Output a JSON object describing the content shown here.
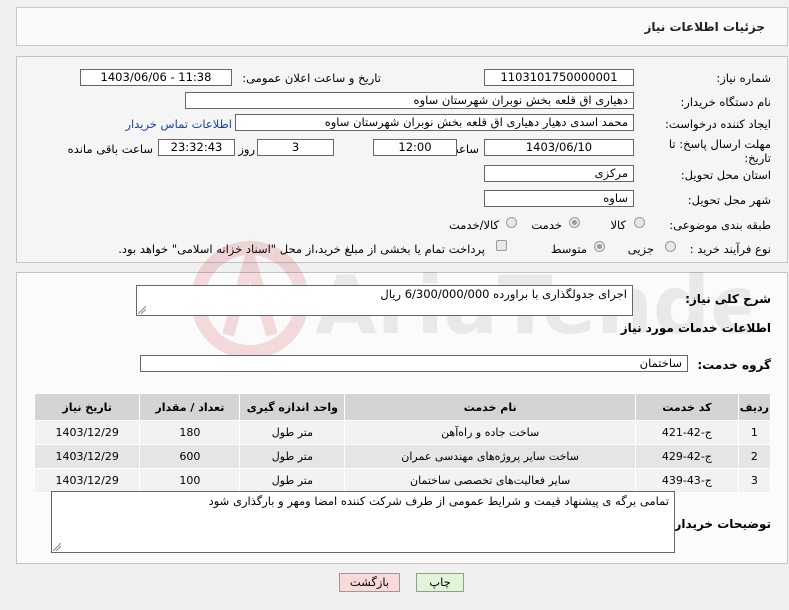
{
  "header": {
    "title": "جزئیات اطلاعات نیاز"
  },
  "info": {
    "need_number_label": "شماره نیاز:",
    "need_number": "1103101750000001",
    "announce_label": "تاریخ و ساعت اعلان عمومی:",
    "announce_value": "1403/06/06 - 11:38",
    "buyer_org_label": "نام دستگاه خریدار:",
    "buyer_org": "دهیاری اق قلعه بخش نوبران شهرستان ساوه",
    "creator_label": "ایجاد کننده درخواست:",
    "creator": "محمد اسدی دهیار دهیاری اق قلعه بخش نوبران شهرستان ساوه",
    "contact_link": "اطلاعات تماس خریدار",
    "deadline_label": "مهلت ارسال پاسخ: تا تاریخ:",
    "deadline_date": "1403/06/10",
    "time_label": "ساعت",
    "deadline_time": "12:00",
    "days_value": "3",
    "days_label": "روز و",
    "remaining_time": "23:32:43",
    "remaining_label": "ساعت باقی مانده",
    "province_label": "استان محل تحویل:",
    "province": "مرکزی",
    "city_label": "شهر محل تحویل:",
    "city": "ساوه",
    "category_label": "طبقه بندی موضوعی:",
    "category_options": [
      "کالا",
      "خدمت",
      "کالا/خدمت"
    ],
    "category_selected": "خدمت",
    "process_label": "نوع فرآیند خرید :",
    "process_options": [
      "جزیی",
      "متوسط"
    ],
    "process_selected": "متوسط",
    "payment_note": "پرداخت تمام یا بخشی از مبلغ خرید،از محل \"اسناد خزانه اسلامی\" خواهد بود."
  },
  "main": {
    "summary_label": "شرح کلی نیاز:",
    "summary_value": "اجرای جدولگذاری با براورده 6/300/000/000 ریال",
    "services_title": "اطلاعات خدمات مورد نیاز",
    "service_group_label": "گروه خدمت:",
    "service_group": "ساختمان",
    "table": {
      "headers": [
        "ردیف",
        "کد خدمت",
        "نام خدمت",
        "واحد اندازه گیری",
        "تعداد / مقدار",
        "تاریخ نیاز"
      ],
      "rows": [
        [
          "1",
          "ج-42-421",
          "ساخت جاده و راه‌آهن",
          "متر طول",
          "180",
          "1403/12/29"
        ],
        [
          "2",
          "ج-42-429",
          "ساخت سایر پروژه‌های مهندسی عمران",
          "متر طول",
          "600",
          "1403/12/29"
        ],
        [
          "3",
          "ج-43-439",
          "سایر فعالیت‌های تخصصی ساختمان",
          "متر طول",
          "100",
          "1403/12/29"
        ]
      ]
    },
    "buyer_notes_label": "توضیحات خریدار:",
    "buyer_notes": "تمامی برگه ی پیشنهاد قیمت و شرایط عمومی از طرف شرکت کننده امضا ومهر و بارگذاری شود"
  },
  "buttons": {
    "print": "چاپ",
    "back": "بازگشت"
  },
  "watermark": {
    "text": "AriaTender.neT"
  },
  "colors": {
    "link": "#1a3ea8",
    "print_bg": "#dff5d8",
    "back_bg": "#f9d9d9",
    "table_header": "#d4d4d4"
  }
}
